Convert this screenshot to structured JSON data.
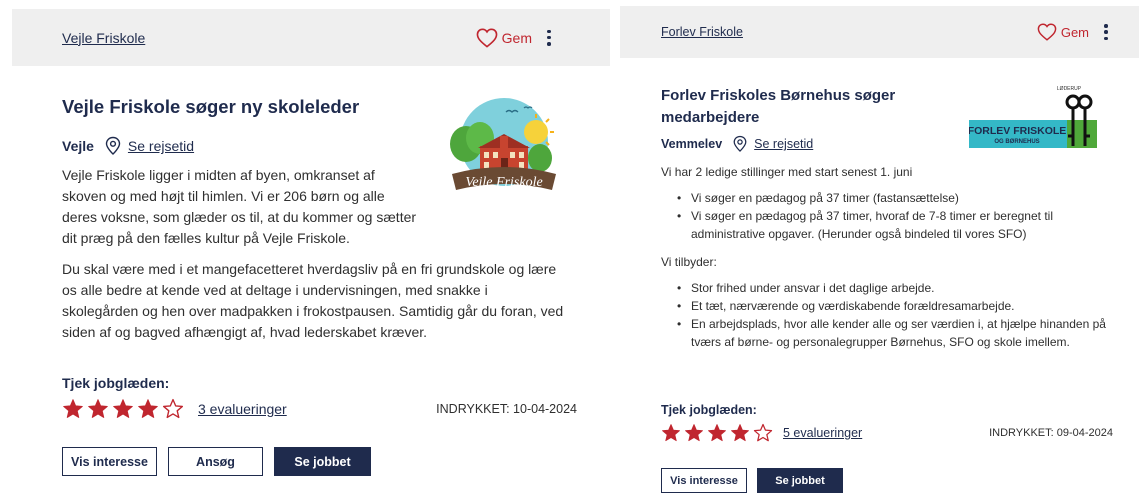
{
  "listings": [
    {
      "company": "Vejle Friskole",
      "save_label": "Gem",
      "title": "Vejle Friskole søger ny skoleleder",
      "location": "Vejle",
      "travel_link": "Se rejsetid",
      "paragraphs": [
        "Vejle Friskole ligger i midten af byen, omkranset af skoven og med højt til himlen. Vi er 206 børn og alle deres voksne, som glæder os til, at du kommer og sætter dit præg på den fælles kultur på Vejle Friskole.",
        "Du skal være med i et mangefacetteret hverdagsliv på en fri grundskole og lære os alle bedre at kende ved at deltage i undervisningen, med snakke i skolegården og hen over madpakken i frokostpausen. Samtidig går du foran, ved siden af og bagved afhængigt af, hvad lederskabet kræver."
      ],
      "logo_text": "Vejle Friskole",
      "rating_heading": "Tjek jobglæden:",
      "rating_stars": 4,
      "rating_max": 5,
      "reviews_link": "3 evalueringer",
      "posted": "INDRYKKET: 10-04-2024",
      "buttons": {
        "interest": "Vis interesse",
        "apply": "Ansøg",
        "view": "Se jobbet"
      }
    },
    {
      "company": "Forlev Friskole",
      "save_label": "Gem",
      "title": "Forlev Friskoles Børnehus søger medarbejdere",
      "location": "Vemmelev",
      "travel_link": "Se rejsetid",
      "intro": "Vi har 2 ledige stillinger med start senest 1. juni",
      "positions": [
        "Vi søger en pædagog på 37 timer (fastansættelse)",
        "Vi søger en pædagog på 37 timer, hvoraf de 7-8 timer er beregnet til administrative opgaver. (Herunder også bindeled til vores SFO)"
      ],
      "offer_heading": "Vi tilbyder:",
      "offers": [
        "Stor frihed under ansvar i det daglige arbejde.",
        "Et tæt, nærværende og værdiskabende forældresamarbejde.",
        "En arbejdsplads, hvor alle kender alle og ser værdien i, at hjælpe hinanden på tværs af børne- og personalegrupper Børnehus, SFO og skole imellem."
      ],
      "logo_line1": "FORLEV FRISKOLE",
      "logo_line2": "OG BØRNEHUS",
      "logo_arc": "LØDERUP",
      "rating_heading": "Tjek jobglæden:",
      "rating_stars": 4,
      "rating_max": 5,
      "reviews_link": "5 evalueringer",
      "posted": "INDRYKKET: 09-04-2024",
      "buttons": {
        "interest": "Vis interesse",
        "view": "Se jobbet"
      }
    }
  ],
  "colors": {
    "navy": "#1f2b4d",
    "red": "#c0262f",
    "topbar": "#efefef"
  }
}
